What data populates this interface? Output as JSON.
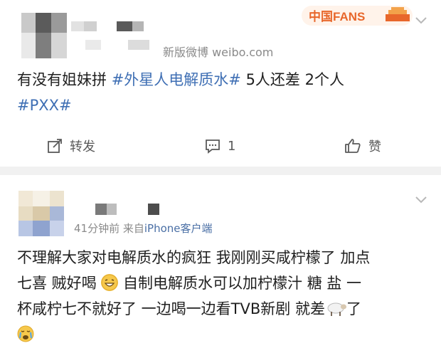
{
  "post1": {
    "meta_text": "新版微博 weibo.com",
    "text_line1_a": "有没有姐妹拼 ",
    "hashtag1": "#外星人电解质水#",
    "text_line1_b": "  5人还差 2个人",
    "hashtag2": "#PXX#",
    "badge_label": "中国FANS",
    "actions": {
      "repost_label": "转发",
      "comment_count": "1",
      "like_label": "赞"
    }
  },
  "post2": {
    "time_text": "41分钟前",
    "source_prefix": "来自",
    "source_name": "iPhone客户端",
    "line1": "不理解大家对电解质水的疯狂 我刚刚买咸柠檬了 加点",
    "line2a": "七喜 贼好喝 ",
    "line2b": " 自制电解质水可以加柠檬汁 糖 盐 一",
    "line3a": "杯咸柠七不就好了 一边喝一边看TVB新剧 就差",
    "line3b": "了"
  },
  "icons": [
    "chevron-down-icon",
    "repost-icon",
    "comment-icon",
    "like-icon",
    "grin-emoji-icon",
    "sheep-emoji-icon",
    "crying-emoji-icon"
  ],
  "colors": {
    "hashtag": "#3f6fb4",
    "meta": "#8a8a8a",
    "divider": "#f1f1f1",
    "badge": "#e8672b"
  }
}
